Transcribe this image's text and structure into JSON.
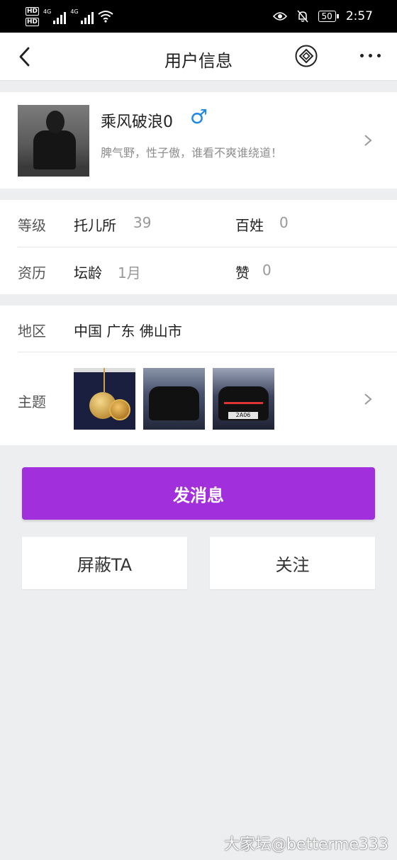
{
  "status_bar": {
    "hd1": "HD",
    "hd2": "HD",
    "net1": "4G",
    "net2": "4G",
    "battery": "50",
    "time": "2:57"
  },
  "nav": {
    "title": "用户信息"
  },
  "profile": {
    "username": "乘风破浪0",
    "gender_symbol": "♂",
    "signature": "脾气野，性子傲，谁看不爽谁绕道！"
  },
  "stats": {
    "level_label": "等级",
    "level_name": "托儿所",
    "level_value": "39",
    "baixing_label": "百姓",
    "baixing_value": "0",
    "seniority_label": "资历",
    "tanling_label": "坛龄",
    "tanling_value": "1月",
    "zan_label": "赞",
    "zan_value": "0"
  },
  "info": {
    "region_label": "地区",
    "region_value": "中国 广东 佛山市",
    "topic_label": "主题",
    "plate_text": "2A06"
  },
  "actions": {
    "message": "发消息",
    "block": "屏蔽TA",
    "follow": "关注"
  },
  "watermark": "大家坛@betterme333",
  "colors": {
    "accent": "#a22fdc",
    "gender_blue": "#1e88e5"
  }
}
